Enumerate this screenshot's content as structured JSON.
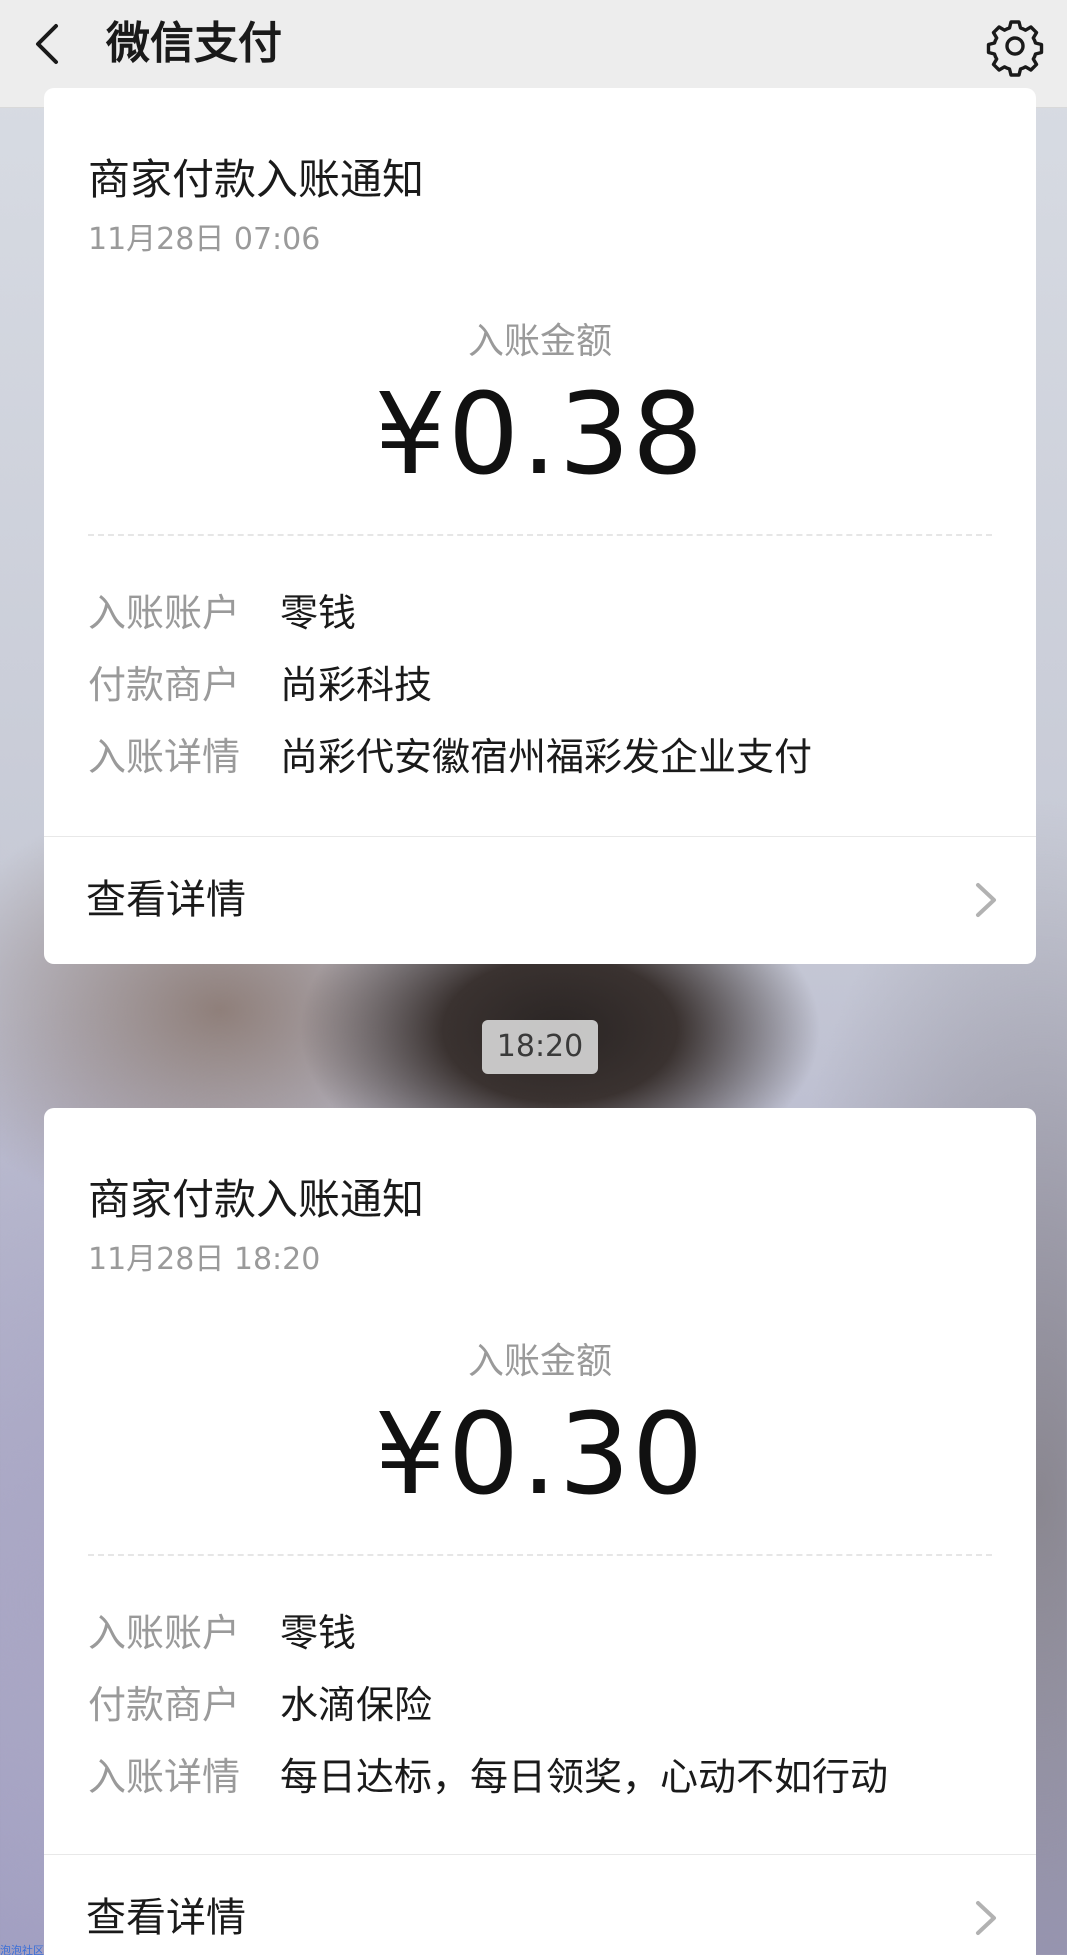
{
  "header": {
    "title": "微信支付"
  },
  "messages": [
    {
      "title": "商家付款入账通知",
      "date": "11月28日  07:06",
      "amount_label": "入账金额",
      "amount": "¥0.38",
      "rows": [
        {
          "key": "入账账户",
          "value": "零钱"
        },
        {
          "key": "付款商户",
          "value": "尚彩科技"
        },
        {
          "key": "入账详情",
          "value": "尚彩代安徽宿州福彩发企业支付"
        }
      ],
      "detail_link": "查看详情"
    },
    {
      "title": "商家付款入账通知",
      "date": "11月28日  18:20",
      "amount_label": "入账金额",
      "amount": "¥0.30",
      "rows": [
        {
          "key": "入账账户",
          "value": "零钱"
        },
        {
          "key": "付款商户",
          "value": "水滴保险"
        },
        {
          "key": "入账详情",
          "value": "每日达标，每日领奖，心动不如行动"
        }
      ],
      "detail_link": "查看详情"
    }
  ],
  "time_separator": "18:20",
  "watermark": "泡泡社区",
  "icons": {
    "back": "back-chevron-icon",
    "settings": "gear-icon",
    "detail_arrow": "chevron-right-icon"
  },
  "colors": {
    "topbar_bg": "#ededed",
    "card_bg": "#ffffff",
    "muted_text": "#9a9a9a",
    "primary_text": "#1a1a1a"
  }
}
